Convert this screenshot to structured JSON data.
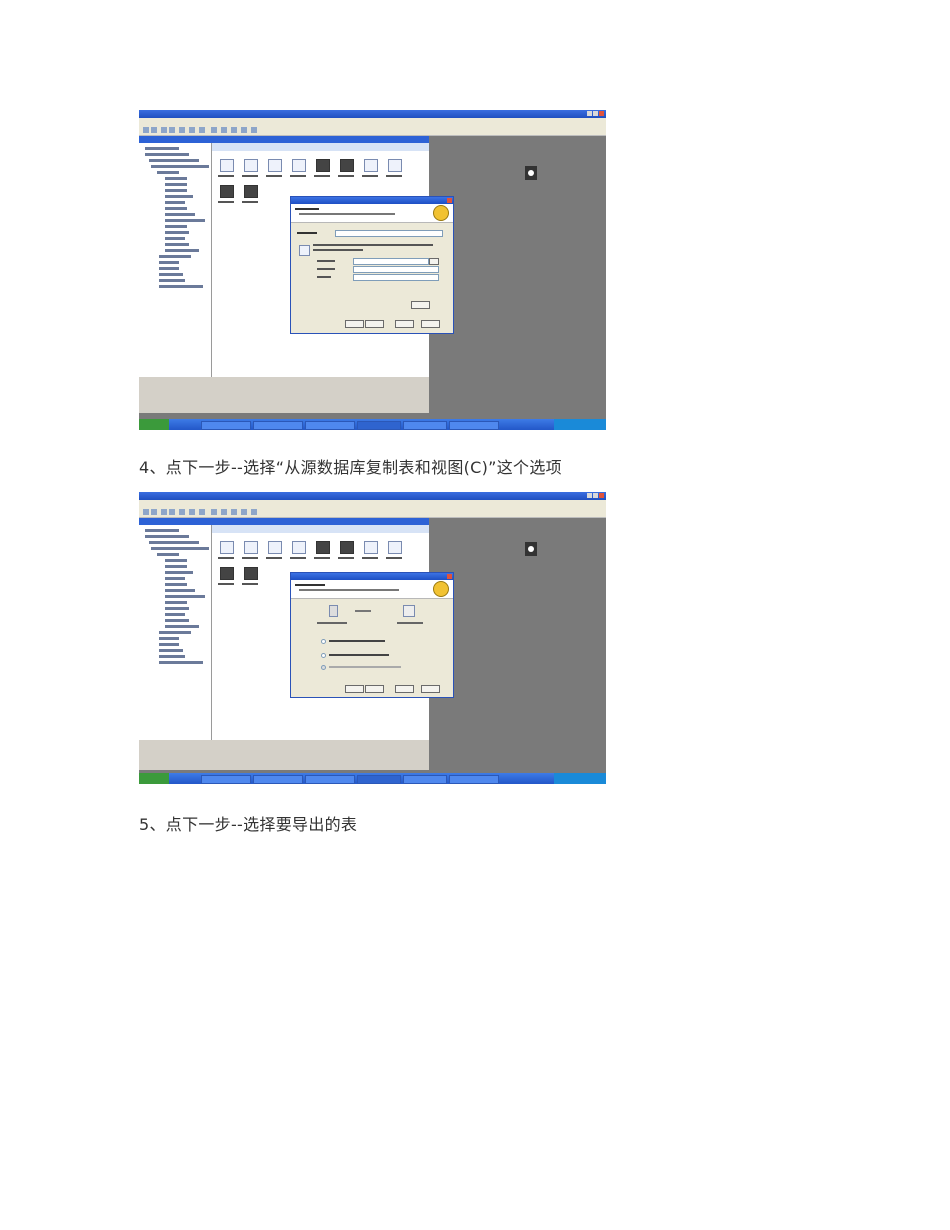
{
  "steps": [
    {
      "text": "4、点下一步--选择“从源数据库复制表和视图(C)”这个选项"
    },
    {
      "text": "5、点下一步--选择要导出的表"
    }
  ],
  "screenshots": [
    {
      "icon": "sql-server-enterprise-manager-window",
      "dialog": "dts-import-export-wizard-choose-data-source"
    },
    {
      "icon": "sql-server-enterprise-manager-window",
      "dialog": "dts-import-export-wizard-copy-tables-option"
    }
  ]
}
